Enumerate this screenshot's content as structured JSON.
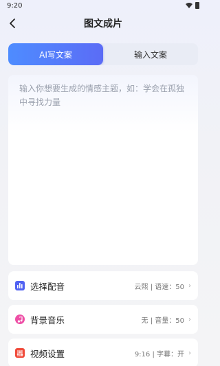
{
  "status": {
    "time": "9:20"
  },
  "header": {
    "title": "图文成片"
  },
  "tabs": [
    {
      "label": "AI写文案",
      "active": true
    },
    {
      "label": "输入文案",
      "active": false
    }
  ],
  "editor": {
    "placeholder": "输入你想要生成的情感主题，如：学会在孤独中寻找力量",
    "value": ""
  },
  "settings": [
    {
      "label": "选择配音",
      "value": "云熙 | 语速：50",
      "icon": "voice-bars-icon",
      "color": "#4b5cf0"
    },
    {
      "label": "背景音乐",
      "value": "无 | 音量：50",
      "icon": "music-note-icon",
      "color": "#e64ca0"
    },
    {
      "label": "视频设置",
      "value": "9:16 | 字幕：开",
      "icon": "sliders-icon",
      "color": "#f04a3a"
    }
  ]
}
